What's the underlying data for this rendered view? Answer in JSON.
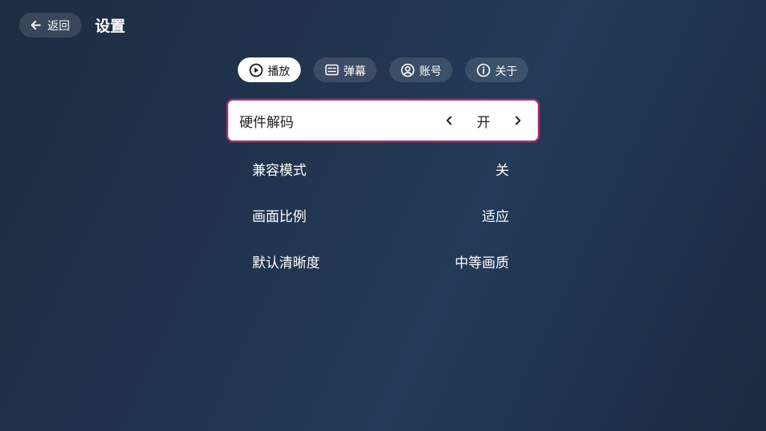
{
  "header": {
    "back_label": "返回",
    "title": "设置"
  },
  "tabs": [
    {
      "label": "播放",
      "icon": "play-circle-icon",
      "active": true
    },
    {
      "label": "弹幕",
      "icon": "danmaku-icon",
      "active": false
    },
    {
      "label": "账号",
      "icon": "account-icon",
      "active": false
    },
    {
      "label": "关于",
      "icon": "info-icon",
      "active": false
    }
  ],
  "settings": [
    {
      "label": "硬件解码",
      "value": "开",
      "focused": true
    },
    {
      "label": "兼容模式",
      "value": "关",
      "focused": false
    },
    {
      "label": "画面比例",
      "value": "适应",
      "focused": false
    },
    {
      "label": "默认清晰度",
      "value": "中等画质",
      "focused": false
    }
  ],
  "colors": {
    "focus_border": "#b0306a",
    "background_start": "#1e2c41",
    "background_end": "#233b58"
  }
}
